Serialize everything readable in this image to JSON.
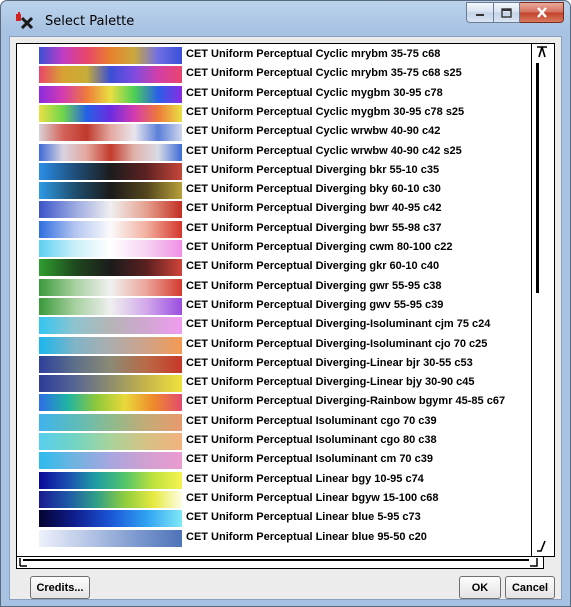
{
  "window": {
    "title": "Select Palette",
    "icon": "app-logo-icon"
  },
  "title_buttons": {
    "minimize_icon": "minimize-icon",
    "maximize_icon": "maximize-icon",
    "close_icon": "close-icon"
  },
  "buttons": {
    "credits": "Credits...",
    "ok": "OK",
    "cancel": "Cancel"
  },
  "palettes": [
    {
      "label": "CET Uniform Perceptual Cyclic mrybm 35-75 c68",
      "colors": [
        "#3a4fd6",
        "#c03cc4",
        "#e8456b",
        "#e8802e",
        "#c9a83e",
        "#6f6fe6",
        "#3a4fd6"
      ]
    },
    {
      "label": "CET Uniform Perceptual Cyclic mrybm 35-75 c68 s25",
      "colors": [
        "#e8456b",
        "#d9a233",
        "#c7ad37",
        "#3a4fd6",
        "#7f4be0",
        "#d23fa8",
        "#e8456b"
      ]
    },
    {
      "label": "CET Uniform Perceptual Cyclic mygbm 30-95 c78",
      "colors": [
        "#8a2be2",
        "#d43bb0",
        "#ee7a3a",
        "#e9e043",
        "#4ccf55",
        "#2a5fe8",
        "#8a2be2"
      ]
    },
    {
      "label": "CET Uniform Perceptual Cyclic mygbm 30-95 c78 s25",
      "colors": [
        "#e9e043",
        "#6fd64a",
        "#2460e6",
        "#6b2ce0",
        "#d43bb0",
        "#ee7a3a",
        "#e9e043"
      ]
    },
    {
      "label": "CET Uniform Perceptual Cyclic wrwbw 40-90 c42",
      "colors": [
        "#d9d2d6",
        "#d4635a",
        "#c0392b",
        "#e3a89f",
        "#e9e6ee",
        "#5a7fd8",
        "#d0d6ee"
      ]
    },
    {
      "label": "CET Uniform Perceptual Cyclic wrwbw 40-90 c42 s25",
      "colors": [
        "#3c6ad6",
        "#d9d3e0",
        "#e4a69c",
        "#c33b2c",
        "#e0b3ab",
        "#d9dbe6",
        "#3c6ad6"
      ]
    },
    {
      "label": "CET Uniform Perceptual Diverging bkr 55-10 c35",
      "colors": [
        "#2a8ee8",
        "#1f4f7a",
        "#1c1c1c",
        "#5e2222",
        "#c5473a"
      ]
    },
    {
      "label": "CET Uniform Perceptual Diverging bky 60-10 c30",
      "colors": [
        "#2e9ae6",
        "#1f4f70",
        "#1b1b1b",
        "#53451d",
        "#b7a03a"
      ]
    },
    {
      "label": "CET Uniform Perceptual Diverging bwr 40-95 c42",
      "colors": [
        "#3b55c9",
        "#9aa8e0",
        "#efeff0",
        "#e6a18f",
        "#c22e21"
      ]
    },
    {
      "label": "CET Uniform Perceptual Diverging bwr 55-98 c37",
      "colors": [
        "#2f6ee0",
        "#b2c4f0",
        "#fbfbfb",
        "#f2b0a0",
        "#d4362b"
      ]
    },
    {
      "label": "CET Uniform Perceptual Diverging cwm 80-100 c22",
      "colors": [
        "#5ed0f0",
        "#c9eff9",
        "#ffffff",
        "#f6d3f2",
        "#ef8fe6"
      ]
    },
    {
      "label": "CET Uniform Perceptual Diverging gkr 60-10 c40",
      "colors": [
        "#2e9e2e",
        "#1f4a1f",
        "#1b1b1b",
        "#5a2020",
        "#d0443a"
      ]
    },
    {
      "label": "CET Uniform Perceptual Diverging gwr 55-95 c38",
      "colors": [
        "#3c9a3c",
        "#a6d09f",
        "#f0f0f0",
        "#eca59a",
        "#d33a2e"
      ]
    },
    {
      "label": "CET Uniform Perceptual Diverging gwv 55-95 c39",
      "colors": [
        "#3a9a3a",
        "#a6d09f",
        "#efefef",
        "#d2a9ea",
        "#9a4de0"
      ]
    },
    {
      "label": "CET Uniform Perceptual Diverging-Isoluminant cjm 75 c24",
      "colors": [
        "#32c6f2",
        "#8fc4cf",
        "#b5b5b5",
        "#d0a6d2",
        "#f09cf0"
      ]
    },
    {
      "label": "CET Uniform Perceptual Diverging-Isoluminant cjo 70 c25",
      "colors": [
        "#19b6ee",
        "#7fb4c6",
        "#adadad",
        "#d0a288",
        "#f39a52"
      ]
    },
    {
      "label": "CET Uniform Perceptual Diverging-Linear bjr 30-55 c53",
      "colors": [
        "#2f3f9e",
        "#5c708a",
        "#8b8a74",
        "#b86a46",
        "#c8372a"
      ]
    },
    {
      "label": "CET Uniform Perceptual Diverging-Linear bjy 30-90 c45",
      "colors": [
        "#2c3b9a",
        "#566693",
        "#8e8d6c",
        "#c6b54a",
        "#f0e23c"
      ]
    },
    {
      "label": "CET Uniform Perceptual Diverging-Rainbow bgymr 45-85 c67",
      "colors": [
        "#2c6ee8",
        "#20b3a4",
        "#8ec83a",
        "#e9d83a",
        "#ee8a2c",
        "#e24b6e"
      ]
    },
    {
      "label": "CET Uniform Perceptual Isoluminant cgo 70 c39",
      "colors": [
        "#3fb3ee",
        "#5cbcbc",
        "#8dbb8d",
        "#c3ab76",
        "#e89a6e"
      ]
    },
    {
      "label": "CET Uniform Perceptual Isoluminant cgo 80 c38",
      "colors": [
        "#58cff0",
        "#72d4c2",
        "#a8d39b",
        "#d6c284",
        "#f2b27e"
      ]
    },
    {
      "label": "CET Uniform Perceptual Isoluminant cm 70 c39",
      "colors": [
        "#2bbbee",
        "#70b3e0",
        "#a8a6e0",
        "#d0a0d0",
        "#eb9bd0"
      ]
    },
    {
      "label": "CET Uniform Perceptual Linear bgy 10-95 c74",
      "colors": [
        "#0a0a9a",
        "#1a4fb0",
        "#1f9ea4",
        "#52c46a",
        "#bfe23c",
        "#f6f252"
      ]
    },
    {
      "label": "CET Uniform Perceptual Linear bgyw 15-100 c68",
      "colors": [
        "#1a1a90",
        "#1e58a8",
        "#2f9e88",
        "#8ecd3e",
        "#e7e940",
        "#fdfde6"
      ]
    },
    {
      "label": "CET Uniform Perceptual Linear blue 5-95 c73",
      "colors": [
        "#030332",
        "#0f1e8f",
        "#1b55d6",
        "#2ea2f2",
        "#7fe8f6"
      ]
    },
    {
      "label": "CET Uniform Perceptual Linear blue 95-50 c20",
      "colors": [
        "#eef1fb",
        "#b7c7e6",
        "#7f9bd0",
        "#4f73b8"
      ]
    }
  ]
}
